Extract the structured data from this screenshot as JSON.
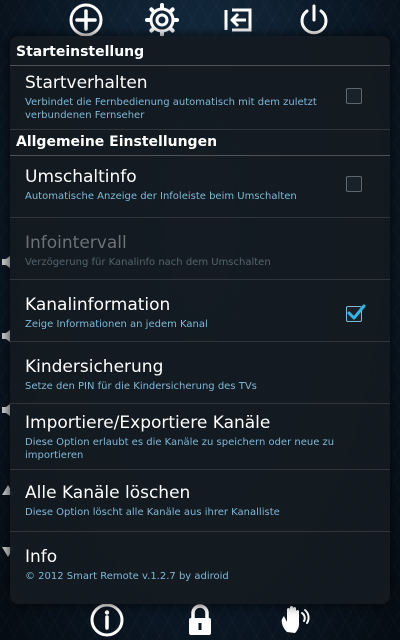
{
  "sections": {
    "start_header": "Starteinstellung",
    "general_header": "Allgemeine Einstellungen"
  },
  "prefs": {
    "startup": {
      "title": "Startverhalten",
      "summary": "Verbindet die Fernbedienung automatisch mit dem zuletzt verbundenen Fernseher",
      "checked": false
    },
    "zapinfo": {
      "title": "Umschaltinfo",
      "summary": "Automatische Anzeige der Infoleiste beim Umschalten",
      "checked": false
    },
    "infointerval": {
      "title": "Infointervall",
      "summary": "Verzögerung für Kanalinfo nach dem Umschalten",
      "enabled": false
    },
    "channelinfo": {
      "title": "Kanalinformation",
      "summary": "Zeige Informationen an jedem Kanal",
      "checked": true
    },
    "parental": {
      "title": "Kindersicherung",
      "summary": "Setze den PIN für die Kindersicherung des TVs"
    },
    "import_export": {
      "title": "Importiere/Exportiere Kanäle",
      "summary": "Diese Option erlaubt es die Kanäle zu speichern oder neue zu importieren"
    },
    "delete_all": {
      "title": "Alle Kanäle löschen",
      "summary": "Diese Option löscht alle Kanäle aus ihrer Kanalliste"
    },
    "info": {
      "title": "Info",
      "summary": "© 2012 Smart Remote v.1.2.7 by adiroid"
    }
  },
  "top_icons": [
    "plus-icon",
    "gear-icon",
    "input-source-icon",
    "power-icon"
  ],
  "bottom_icons": [
    "info-icon",
    "lock-icon",
    "hand-gesture-icon"
  ],
  "colors": {
    "summary": "#7fb9d8",
    "check_accent": "#33b5e5",
    "dialog_bg": "#141a20"
  }
}
